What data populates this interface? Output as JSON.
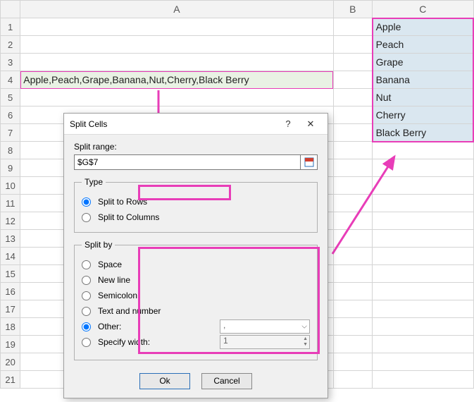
{
  "columns": {
    "A": "A",
    "B": "B",
    "C": "C"
  },
  "rows": [
    "1",
    "2",
    "3",
    "4",
    "5",
    "6",
    "7",
    "8",
    "9",
    "10",
    "11",
    "12",
    "13",
    "14",
    "15",
    "16",
    "17",
    "18",
    "19",
    "20",
    "21"
  ],
  "cellA4": "Apple,Peach,Grape,Banana,Nut,Cherry,Black Berry",
  "output": [
    "Apple",
    "Peach",
    "Grape",
    "Banana",
    "Nut",
    "Cherry",
    "Black Berry"
  ],
  "dialog": {
    "title": "Split Cells",
    "help": "?",
    "close": "✕",
    "splitRangeLabel": "Split range:",
    "splitRangeValue": "$G$7",
    "type": {
      "legend": "Type",
      "rows": "Split to Rows",
      "cols": "Split to Columns"
    },
    "splitBy": {
      "legend": "Split by",
      "space": "Space",
      "newline": "New line",
      "semicolon": "Semicolon",
      "textnum": "Text and number",
      "other": "Other:",
      "otherVal": ",",
      "width": "Specify width:",
      "widthVal": "1"
    },
    "ok": "Ok",
    "cancel": "Cancel"
  }
}
